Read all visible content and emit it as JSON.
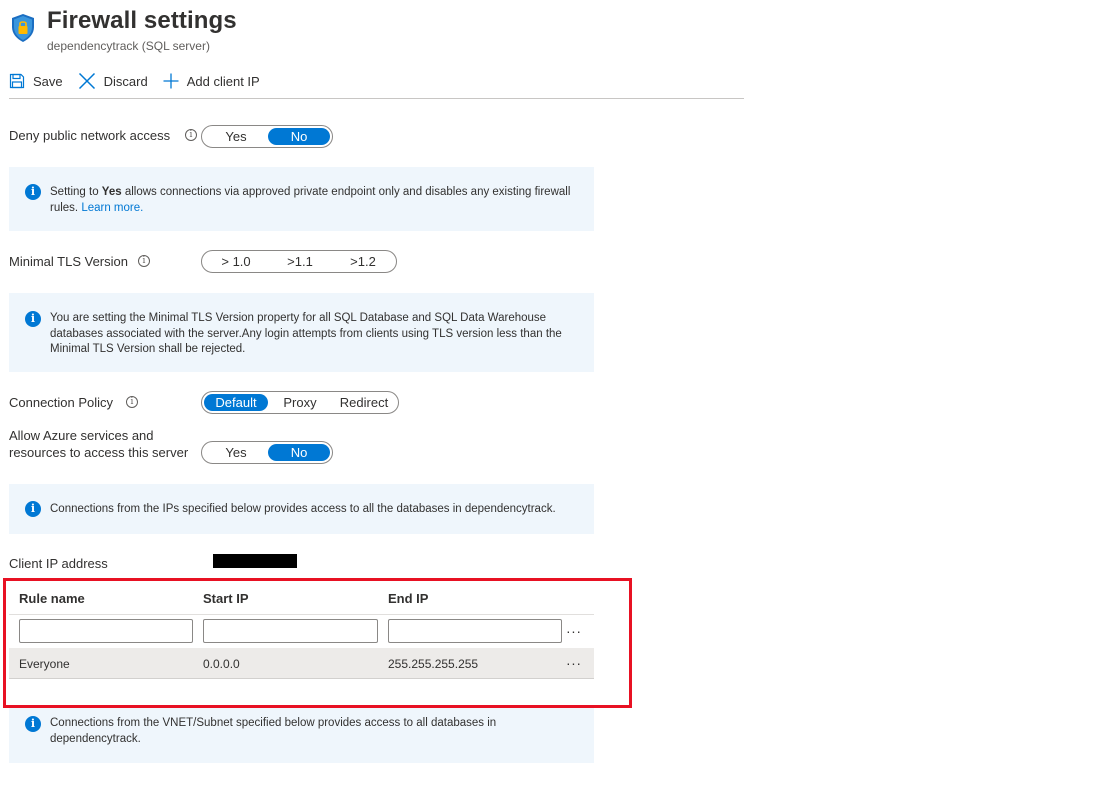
{
  "header": {
    "title": "Firewall settings",
    "subtitle": "dependencytrack (SQL server)",
    "icon": "shield-lock-icon"
  },
  "toolbar": {
    "save_label": "Save",
    "discard_label": "Discard",
    "add_client_ip_label": "Add client IP"
  },
  "deny_public": {
    "label": "Deny public network access",
    "options": [
      "Yes",
      "No"
    ],
    "selected": "No"
  },
  "deny_info": {
    "prefix": "Setting to ",
    "bold": "Yes",
    "text": " allows connections via approved private endpoint only and disables any existing firewall rules. ",
    "link": "Learn more."
  },
  "tls": {
    "label": "Minimal TLS Version",
    "options": [
      "> 1.0",
      ">1.1",
      ">1.2"
    ],
    "selected": null
  },
  "tls_info": {
    "text": "You are setting the Minimal TLS Version property for all SQL Database and SQL Data Warehouse databases associated with the server.Any login attempts from clients using TLS version less than the Minimal TLS Version shall be rejected."
  },
  "connection_policy": {
    "label": "Connection Policy",
    "options": [
      "Default",
      "Proxy",
      "Redirect"
    ],
    "selected": "Default"
  },
  "allow_azure": {
    "label_line1": "Allow Azure services and",
    "label_line2": "resources to access this server",
    "options": [
      "Yes",
      "No"
    ],
    "selected": "No"
  },
  "ip_info": {
    "text": "Connections from the IPs specified below provides access to all the databases in dependencytrack."
  },
  "client_ip": {
    "label": "Client IP address"
  },
  "rules_table": {
    "columns": [
      "Rule name",
      "Start IP",
      "End IP"
    ],
    "new_row": {
      "rule_name": "",
      "start_ip": "",
      "end_ip": ""
    },
    "rows": [
      {
        "rule_name": "Everyone",
        "start_ip": "0.0.0.0",
        "end_ip": "255.255.255.255"
      }
    ],
    "more_label": "···"
  },
  "vnet_info": {
    "text": "Connections from the VNET/Subnet specified below provides access to all databases in dependencytrack."
  },
  "colors": {
    "accent": "#0078d4",
    "info_bg": "#eff6fc",
    "highlight": "#e81123"
  }
}
